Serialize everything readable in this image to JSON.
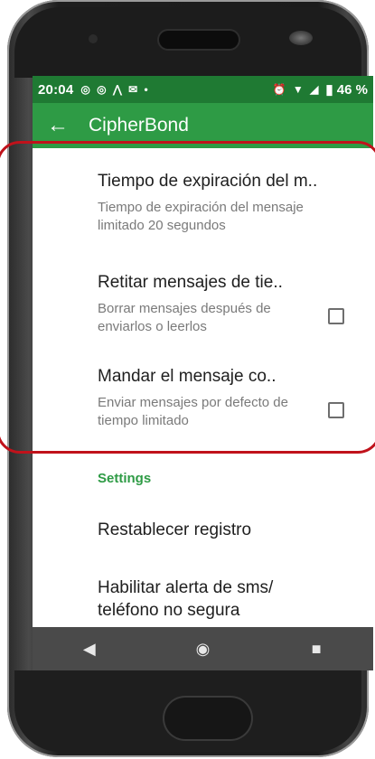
{
  "status_bar": {
    "time": "20:04",
    "left_icons": "◎ ◎ ⋀ ✉ •",
    "right_icons": "⏰ ▼ ◢",
    "battery_text": "▮ 46 %"
  },
  "app_bar": {
    "title": "CipherBond",
    "back_icon": "←"
  },
  "preferences": [
    {
      "title": "Tiempo de expiración del m..",
      "summary": "Tiempo de expiración del mensaje limitado 20 segundos",
      "has_checkbox": false
    },
    {
      "title": "Retitar mensajes de tie..",
      "summary": "Borrar mensajes después de enviarlos o leerlos",
      "has_checkbox": true,
      "checked": false
    },
    {
      "title": "Mandar el mensaje co..",
      "summary": "Enviar mensajes por defecto de tiempo limitado",
      "has_checkbox": true,
      "checked": false
    }
  ],
  "section": {
    "header": "Settings"
  },
  "settings_items": [
    {
      "title": "Restablecer registro"
    },
    {
      "title": "Habilitar alerta de sms/ teléfono no segura"
    }
  ],
  "nav": {
    "back": "◀",
    "home": "◉",
    "recents": "■"
  },
  "colors": {
    "status_bar": "#1f7a33",
    "app_bar": "#2e9b45",
    "accent": "#2e9b45",
    "highlight": "#c0121b"
  }
}
